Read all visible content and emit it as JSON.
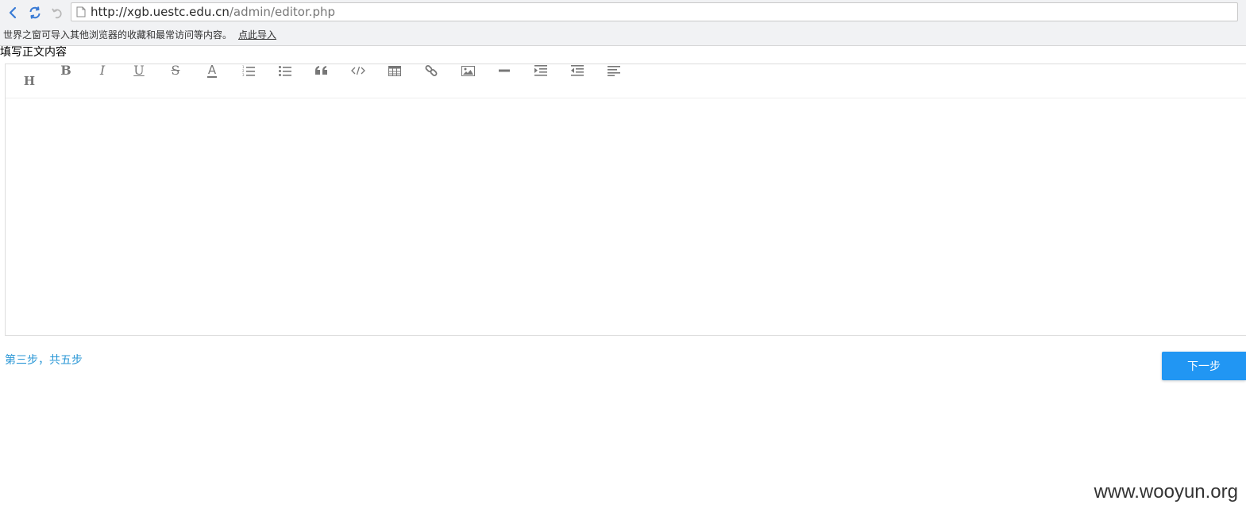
{
  "browser": {
    "url_host": "http://xgb.uestc.edu.cn",
    "url_path": "/admin/editor.php",
    "infobar_text": "世界之窗可导入其他浏览器的收藏和最常访问等内容。",
    "infobar_link": "点此导入",
    "icons": {
      "back": "chevron-left-icon",
      "refresh": "refresh-icon",
      "undo": "undo-icon",
      "page": "page-icon"
    }
  },
  "page": {
    "section_label": "填写正文内容",
    "step_text": "第三步，共五步",
    "next_label": "下一步",
    "accent_color": "#2196f3",
    "step_color": "#2a97d6"
  },
  "toolbar": {
    "tools": [
      {
        "name": "heading",
        "icon": "heading-icon",
        "glyph": "H"
      },
      {
        "name": "bold",
        "icon": "bold-icon",
        "glyph": "B"
      },
      {
        "name": "italic",
        "icon": "italic-icon",
        "glyph": "I"
      },
      {
        "name": "underline",
        "icon": "underline-icon",
        "glyph": "U"
      },
      {
        "name": "strikethrough",
        "icon": "strikethrough-icon",
        "glyph": "S"
      },
      {
        "name": "font-color",
        "icon": "font-color-icon",
        "glyph": "A"
      },
      {
        "name": "ordered-list",
        "icon": "ordered-list-icon"
      },
      {
        "name": "unordered-list",
        "icon": "unordered-list-icon"
      },
      {
        "name": "blockquote",
        "icon": "quote-icon"
      },
      {
        "name": "code",
        "icon": "code-icon"
      },
      {
        "name": "table",
        "icon": "table-icon"
      },
      {
        "name": "link",
        "icon": "link-icon"
      },
      {
        "name": "image",
        "icon": "image-icon"
      },
      {
        "name": "horizontal-rule",
        "icon": "horizontal-rule-icon"
      },
      {
        "name": "indent",
        "icon": "indent-icon"
      },
      {
        "name": "outdent",
        "icon": "outdent-icon"
      },
      {
        "name": "align",
        "icon": "align-left-icon"
      }
    ]
  },
  "watermark": "www.wooyun.org"
}
